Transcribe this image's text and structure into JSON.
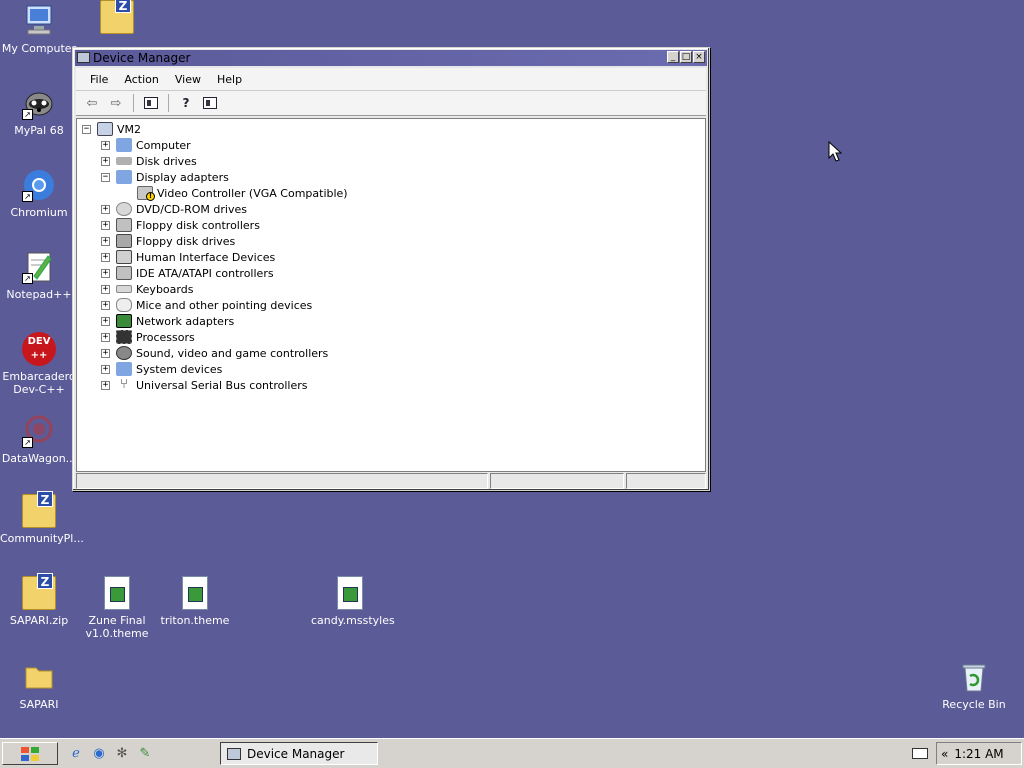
{
  "desktop": {
    "icons": [
      {
        "label": "My Computer",
        "icon": "computer-icon"
      },
      {
        "label": "MyPal 68",
        "icon": "raccoon-icon"
      },
      {
        "label": "Chromium",
        "icon": "chromium-icon"
      },
      {
        "label": "Notepad++",
        "icon": "notepad-icon"
      },
      {
        "label": "Embarcadero Dev-C++",
        "icon": "devcpp-icon",
        "badge": "DEV ++"
      },
      {
        "label": "DataWagon...",
        "icon": "datawagon-icon"
      },
      {
        "label": "CommunityPl...",
        "icon": "zip-folder-icon"
      },
      {
        "label": "SAPARI.zip",
        "icon": "zip-folder-icon"
      },
      {
        "label": "Zune Final v1.0.theme",
        "icon": "theme-file-icon"
      },
      {
        "label": "triton.theme",
        "icon": "theme-file-icon"
      },
      {
        "label": "candy.msstyles",
        "icon": "theme-file-icon"
      },
      {
        "label": "SAPARI",
        "icon": "folder-icon"
      },
      {
        "label": "Recycle Bin",
        "icon": "recycle-bin-icon"
      }
    ],
    "zip_letter": "Z"
  },
  "window": {
    "title": "Device Manager",
    "menu": [
      "File",
      "Action",
      "View",
      "Help"
    ],
    "tree": {
      "root": "VM2",
      "items": [
        {
          "label": "Computer",
          "expander": "+"
        },
        {
          "label": "Disk drives",
          "expander": "+"
        },
        {
          "label": "Display adapters",
          "expander": "−"
        },
        {
          "label": "Video Controller (VGA Compatible)",
          "child": true
        },
        {
          "label": "DVD/CD-ROM drives",
          "expander": "+"
        },
        {
          "label": "Floppy disk controllers",
          "expander": "+"
        },
        {
          "label": "Floppy disk drives",
          "expander": "+"
        },
        {
          "label": "Human Interface Devices",
          "expander": "+"
        },
        {
          "label": "IDE ATA/ATAPI controllers",
          "expander": "+"
        },
        {
          "label": "Keyboards",
          "expander": "+"
        },
        {
          "label": "Mice and other pointing devices",
          "expander": "+"
        },
        {
          "label": "Network adapters",
          "expander": "+"
        },
        {
          "label": "Processors",
          "expander": "+"
        },
        {
          "label": "Sound, video and game controllers",
          "expander": "+"
        },
        {
          "label": "System devices",
          "expander": "+"
        },
        {
          "label": "Universal Serial Bus controllers",
          "expander": "+"
        }
      ]
    }
  },
  "taskbar": {
    "task": "Device Manager",
    "clock": "1:21 AM",
    "tray_toggle": "«"
  },
  "colors": {
    "desktop": "#5b5b97",
    "titlebar": "#6b6bb0",
    "taskbar": "#d6d3ce"
  }
}
